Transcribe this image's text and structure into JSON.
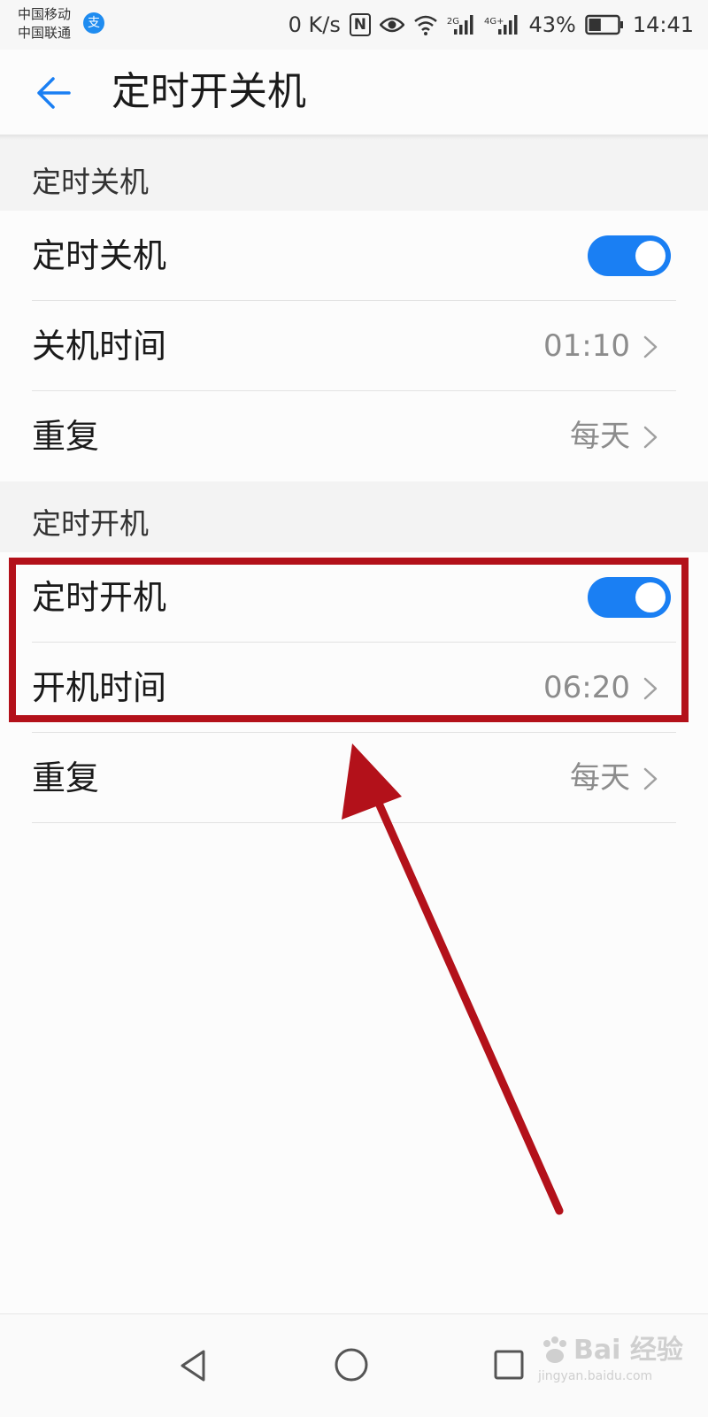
{
  "status_bar": {
    "carrier1": "中国移动",
    "carrier2": "中国联通",
    "alipay_glyph": "支",
    "net_speed": "0 K/s",
    "nfc": "N",
    "net1_tag": "2G",
    "net2_tag": "4G+",
    "battery_percent": "43%",
    "battery_level": 43,
    "time": "14:41"
  },
  "header": {
    "title": "定时开关机",
    "back_icon": "arrow-left-icon"
  },
  "shutdown_section": {
    "title": "定时关机",
    "toggle_row": {
      "label": "定时关机",
      "enabled": true
    },
    "time_row": {
      "label": "关机时间",
      "value": "01:10"
    },
    "repeat_row": {
      "label": "重复",
      "value": "每天"
    }
  },
  "startup_section": {
    "title": "定时开机",
    "toggle_row": {
      "label": "定时开机",
      "enabled": true
    },
    "time_row": {
      "label": "开机时间",
      "value": "06:20"
    },
    "repeat_row": {
      "label": "重复",
      "value": "每天"
    }
  },
  "nav_bar": {
    "icons": [
      "triangle-back-icon",
      "circle-home-icon",
      "square-recent-icon"
    ]
  },
  "watermark": {
    "brand": "Bai 经验",
    "url": "jingyan.baidu.com"
  },
  "colors": {
    "accent": "#1a7ff3",
    "annotation": "#b3111a",
    "section_bg": "#f3f3f3",
    "secondary_text": "#8c8c8c"
  }
}
